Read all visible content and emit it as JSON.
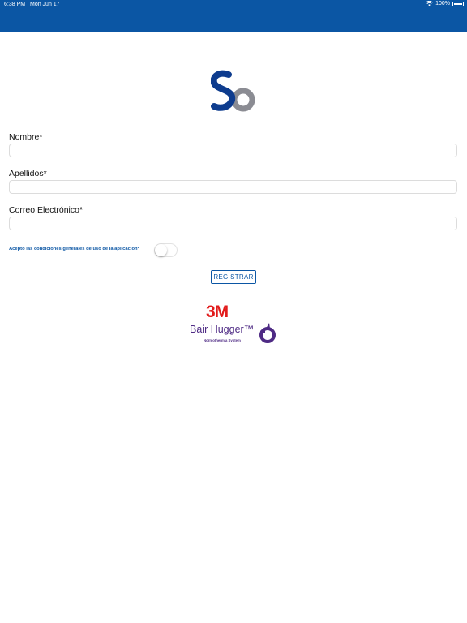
{
  "status_bar": {
    "time": "6:38 PM",
    "date": "Mon Jun 17",
    "battery": "100%"
  },
  "form": {
    "nombre_label": "Nombre*",
    "nombre_value": "",
    "apellidos_label": "Apellidos*",
    "apellidos_value": "",
    "correo_label": "Correo Electrónico*",
    "correo_value": "",
    "terms_prefix": "Acepto las ",
    "terms_link": "condiciones generales",
    "terms_suffix": " de uso de la aplicación*",
    "terms_accepted": false,
    "register_label": "REGISTRAR"
  },
  "brand": {
    "company": "3M",
    "product": "Bair Hugger™",
    "tagline": "Normothermia System"
  },
  "colors": {
    "header": "#0b56a4",
    "accent": "#0b56a4",
    "brand_red": "#e21b1b",
    "brand_purple": "#4e2a84"
  }
}
